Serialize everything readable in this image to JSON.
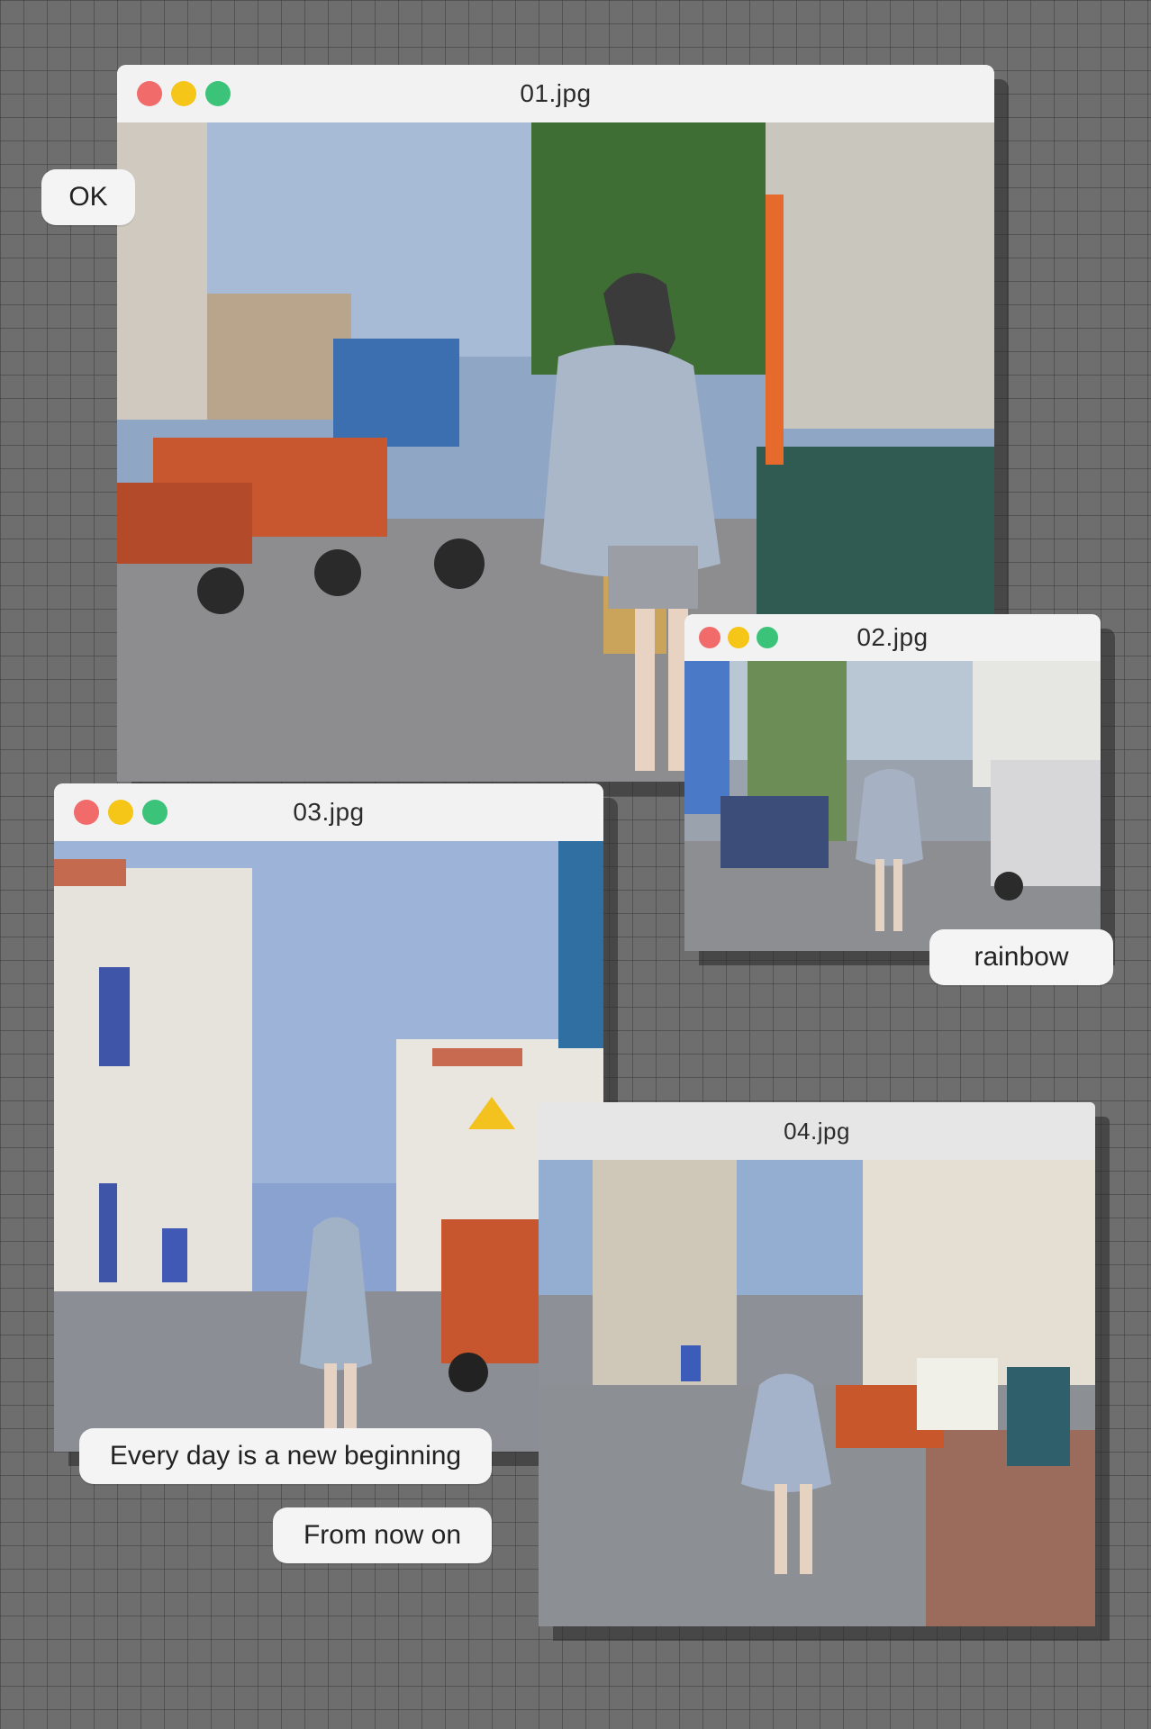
{
  "colors": {
    "close": "#f26b6b",
    "minimize": "#f5c518",
    "maximize": "#3cc37a"
  },
  "windows": [
    {
      "title": "01.jpg"
    },
    {
      "title": "02.jpg"
    },
    {
      "title": "03.jpg"
    },
    {
      "title": "04.jpg"
    }
  ],
  "captions": {
    "ok": "OK",
    "rainbow": "rainbow",
    "every_day": "Every day is a new beginning",
    "from_now": "From now on"
  }
}
